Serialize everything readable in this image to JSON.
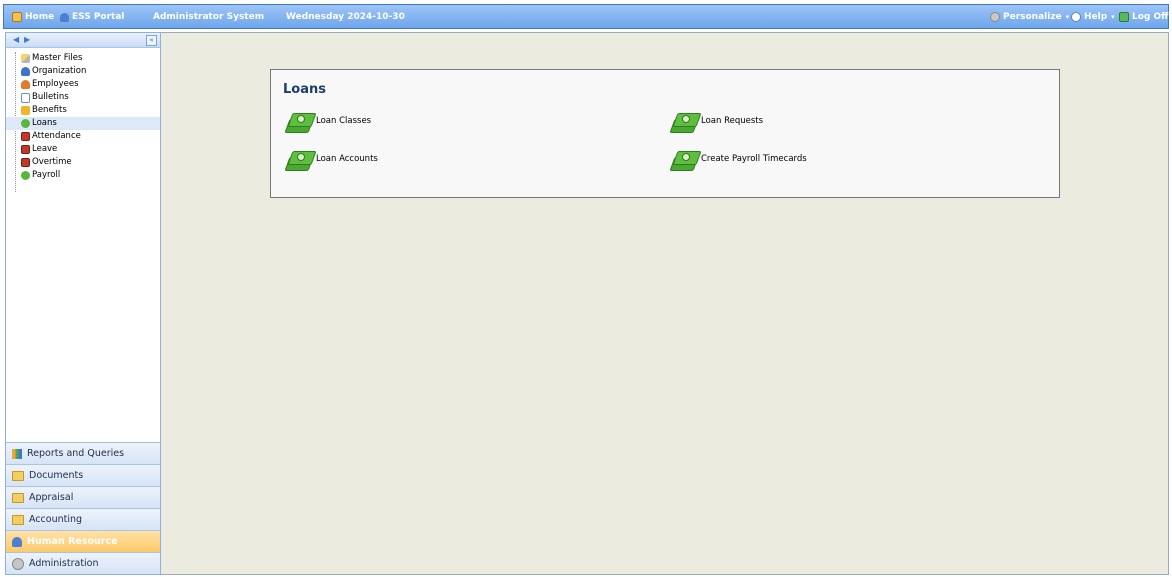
{
  "topbar": {
    "home": "Home",
    "ess_portal": "ESS Portal",
    "system": "Administrator System",
    "date": "Wednesday 2024-10-30",
    "personalize": "Personalize",
    "help": "Help",
    "logoff": "Log Off"
  },
  "tree": {
    "items": [
      {
        "label": "Master Files",
        "icon": "pencil-icon"
      },
      {
        "label": "Organization",
        "icon": "person-icon"
      },
      {
        "label": "Employees",
        "icon": "person-icon"
      },
      {
        "label": "Bulletins",
        "icon": "document-icon"
      },
      {
        "label": "Benefits",
        "icon": "gift-icon"
      },
      {
        "label": "Loans",
        "icon": "money-icon"
      },
      {
        "label": "Attendance",
        "icon": "calendar-icon"
      },
      {
        "label": "Leave",
        "icon": "calendar-icon"
      },
      {
        "label": "Overtime",
        "icon": "calendar-icon"
      },
      {
        "label": "Payroll",
        "icon": "money-icon"
      }
    ],
    "selected": "Loans"
  },
  "accordion": {
    "items": [
      {
        "label": "Reports and Queries"
      },
      {
        "label": "Documents"
      },
      {
        "label": "Appraisal"
      },
      {
        "label": "Accounting"
      },
      {
        "label": "Human Resource"
      },
      {
        "label": "Administration"
      }
    ],
    "active": "Human Resource"
  },
  "main": {
    "title": "Loans",
    "links": [
      {
        "label": "Loan Classes"
      },
      {
        "label": "Loan Requests"
      },
      {
        "label": "Loan Accounts"
      },
      {
        "label": "Create Payroll Timecards"
      }
    ]
  },
  "colors": {
    "topbar": "#6ea6ec",
    "main_bg": "#ecebe0",
    "active_tab": "#ffc96a"
  }
}
